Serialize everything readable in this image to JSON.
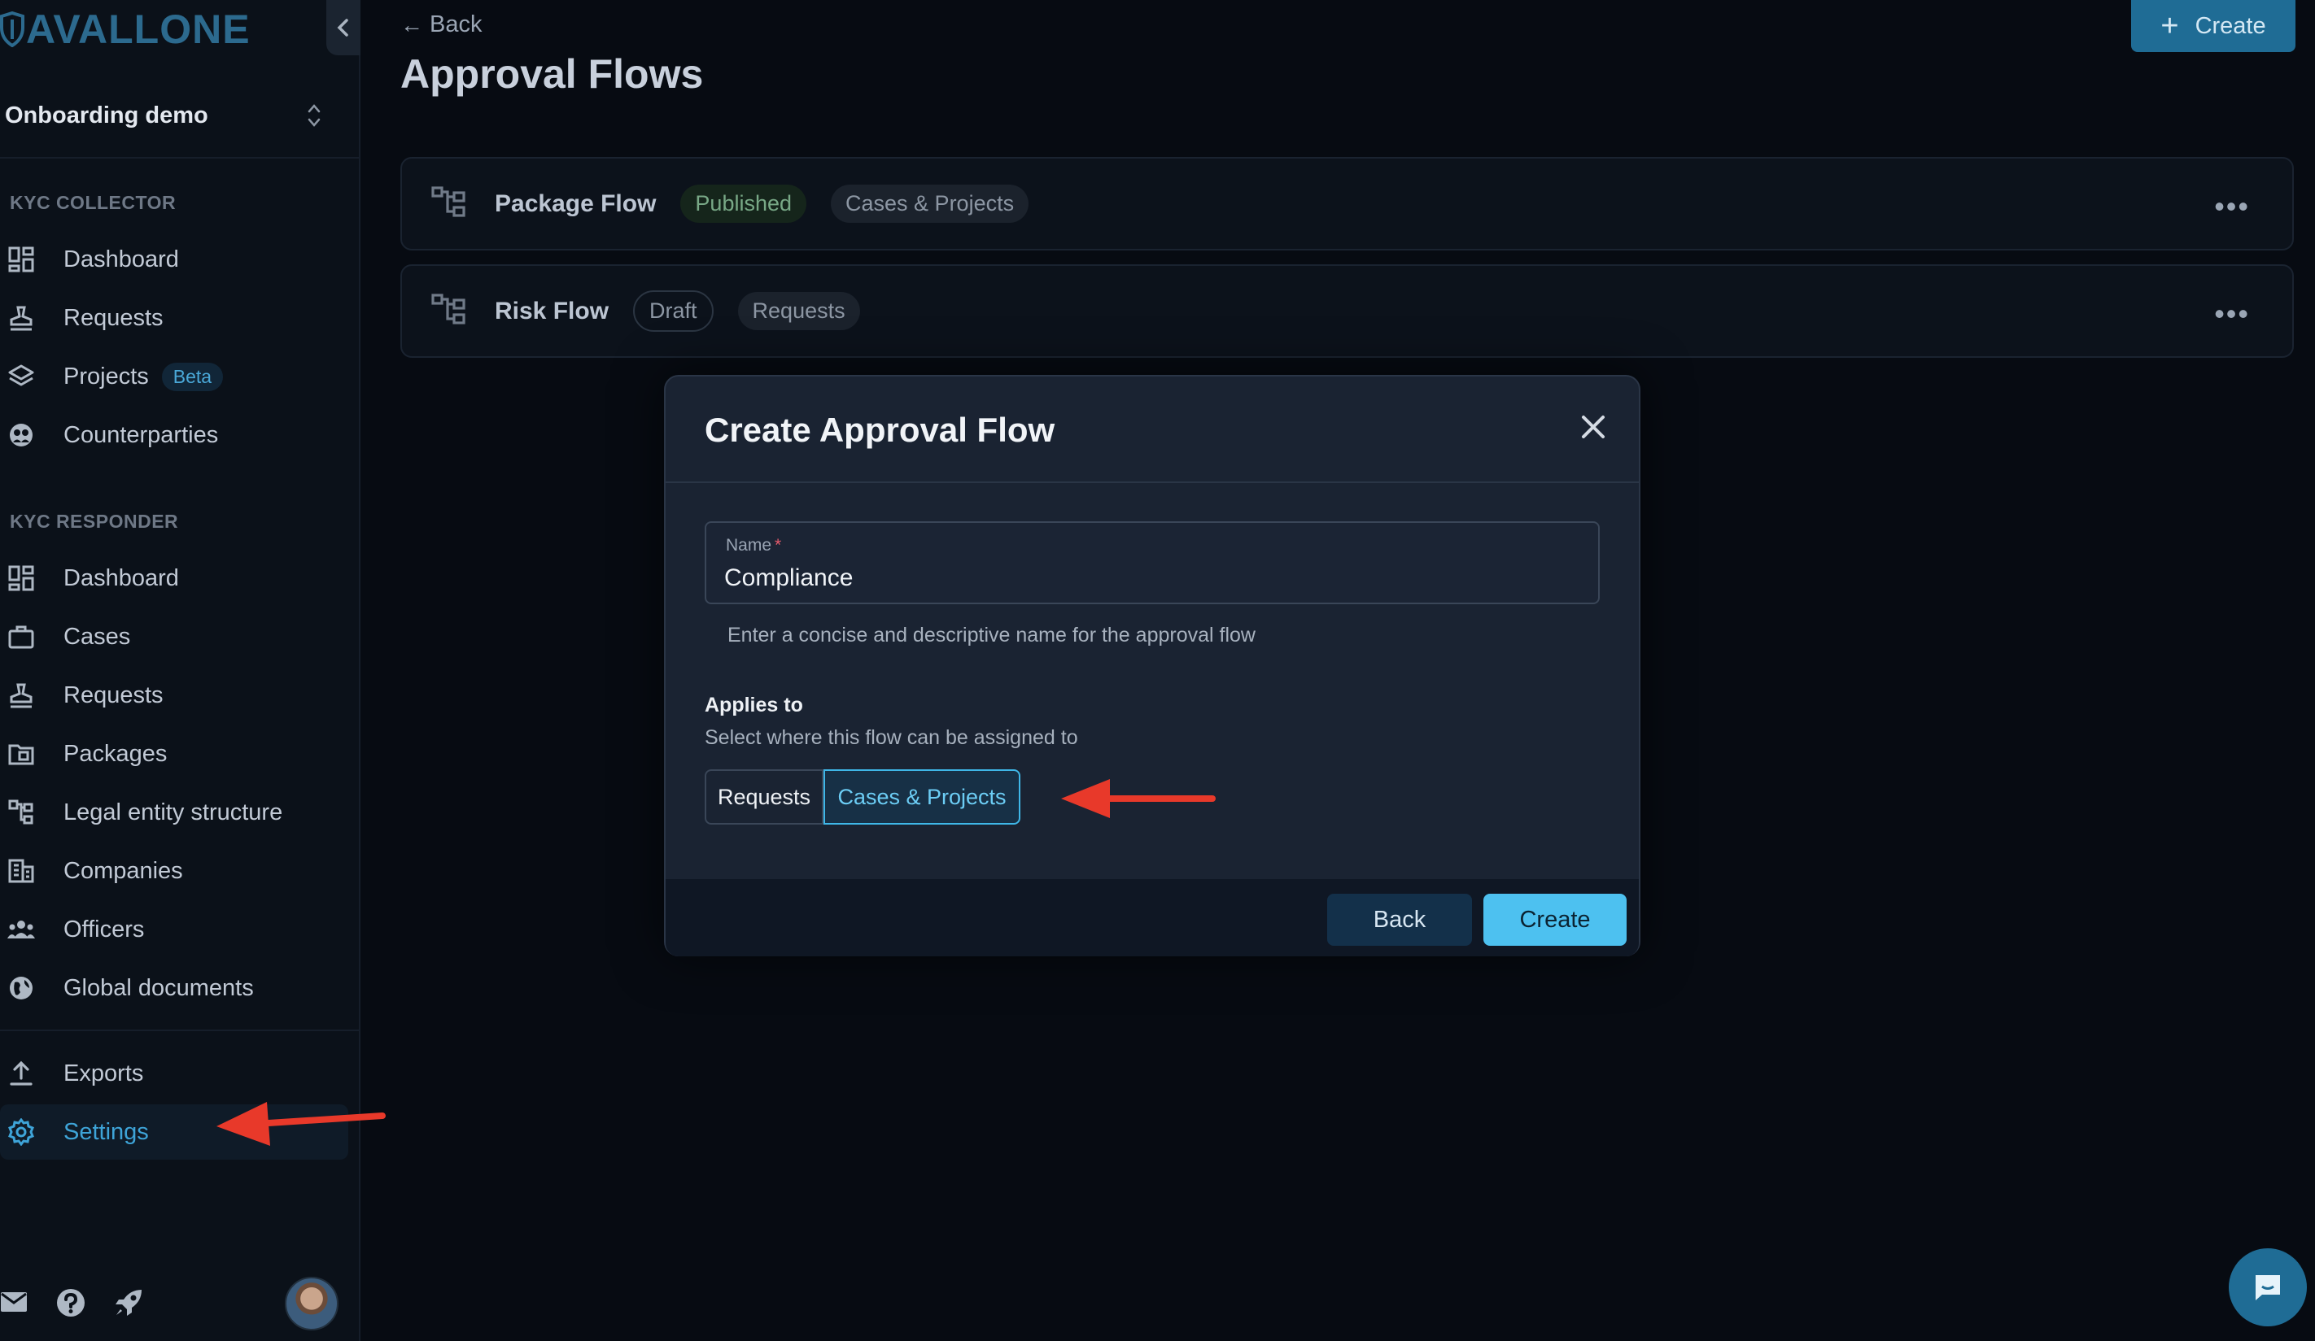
{
  "sidebar": {
    "logo_text": "AVALLONE",
    "org_name": "Onboarding demo",
    "section_collector": "KYC COLLECTOR",
    "section_responder": "KYC RESPONDER",
    "collector_items": [
      {
        "label": "Dashboard",
        "icon": "dashboard-icon"
      },
      {
        "label": "Requests",
        "icon": "stamp-icon"
      },
      {
        "label": "Projects",
        "icon": "layers-icon",
        "badge": "Beta"
      },
      {
        "label": "Counterparties",
        "icon": "counterparties-icon"
      }
    ],
    "responder_items": [
      {
        "label": "Dashboard",
        "icon": "dashboard-icon"
      },
      {
        "label": "Cases",
        "icon": "briefcase-icon"
      },
      {
        "label": "Requests",
        "icon": "stamp-icon"
      },
      {
        "label": "Packages",
        "icon": "package-icon"
      },
      {
        "label": "Legal entity structure",
        "icon": "hierarchy-icon"
      },
      {
        "label": "Companies",
        "icon": "building-icon"
      },
      {
        "label": "Officers",
        "icon": "people-icon"
      },
      {
        "label": "Global documents",
        "icon": "globe-icon"
      }
    ],
    "footer_items": [
      {
        "label": "Exports",
        "icon": "upload-icon"
      },
      {
        "label": "Settings",
        "icon": "gear-icon",
        "active": true
      }
    ]
  },
  "main": {
    "back_label": "Back",
    "page_title": "Approval Flows",
    "create_label": "Create",
    "flows": [
      {
        "name": "Package Flow",
        "status": "Published",
        "scope": "Cases & Projects"
      },
      {
        "name": "Risk Flow",
        "status": "Draft",
        "scope": "Requests"
      }
    ]
  },
  "modal": {
    "title": "Create Approval Flow",
    "name_label": "Name",
    "name_required_mark": "*",
    "name_value": "Compliance",
    "name_helper": "Enter a concise and descriptive name for the approval flow",
    "applies_label": "Applies to",
    "applies_desc": "Select where this flow can be assigned to",
    "options": [
      "Requests",
      "Cases & Projects"
    ],
    "selected_option": "Cases & Projects",
    "back_button": "Back",
    "create_button": "Create"
  },
  "colors": {
    "accent": "#4dc1f0",
    "annotation_arrow": "#e8392a",
    "published": "#78a886"
  }
}
